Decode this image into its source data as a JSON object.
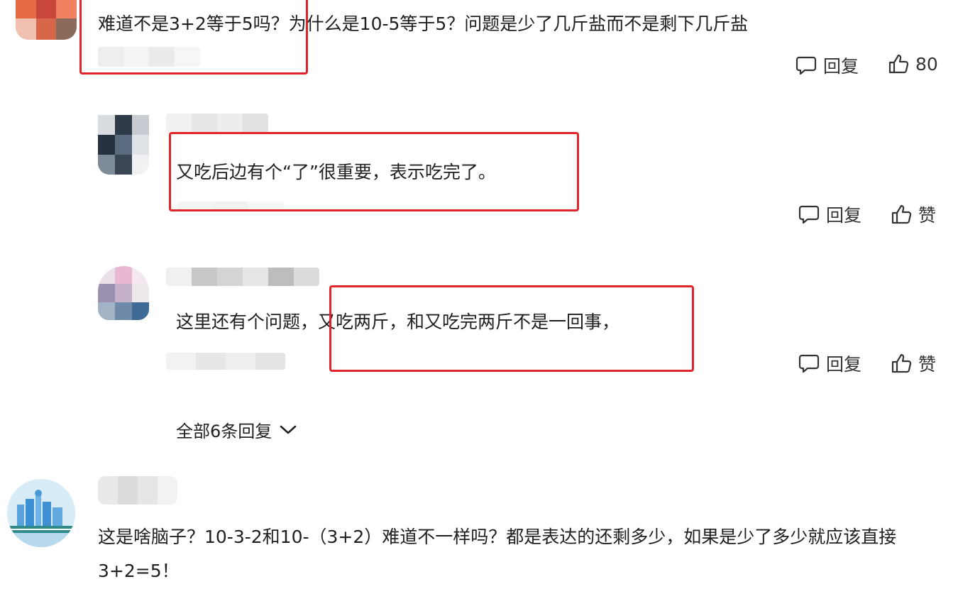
{
  "comments": [
    {
      "text": "难道不是3+2等于5吗？为什么是10-5等于5？问题是少了几斤盐而不是剩下几斤盐",
      "reply_label": "回复",
      "like_label": "80"
    },
    {
      "text": "又吃后边有个“了”很重要，表示吃完了。",
      "reply_label": "回复",
      "like_label": "赞"
    },
    {
      "text": "这里还有个问题，又吃两斤，和又吃完两斤不是一回事，",
      "reply_label": "回复",
      "like_label": "赞"
    },
    {
      "text": "这是啥脑子？10-3-2和10-（3+2）难道不一样吗？都是表达的还剩多少，如果是少了多少就应该直接3+2=5！"
    }
  ],
  "show_all_replies": "全部6条回复",
  "colors": {
    "highlight_box": "#e0242c",
    "text": "#1f1f1f",
    "icon": "#333333"
  },
  "icons": {
    "reply": "comment-bubble-icon",
    "like": "thumbs-up-icon",
    "expand": "chevron-down-icon"
  }
}
